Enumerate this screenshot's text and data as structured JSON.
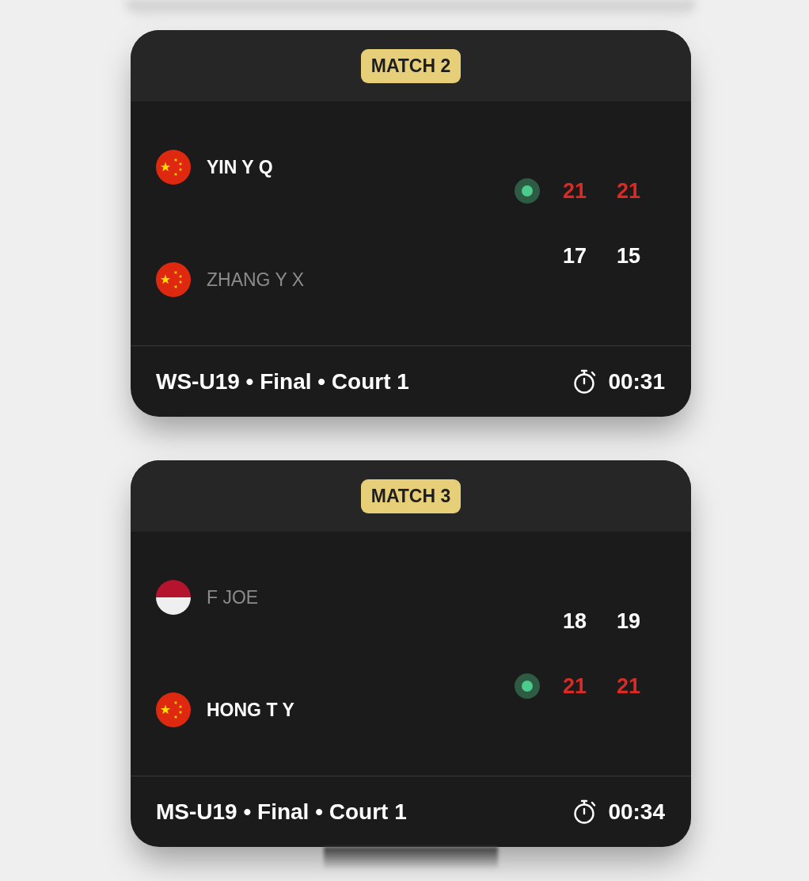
{
  "matches": [
    {
      "badge": "MATCH 2",
      "players": [
        {
          "name": "YIN Y Q",
          "flag": {
            "kind": "china"
          },
          "winner": true,
          "serving": true,
          "scores": [
            "21",
            "21"
          ]
        },
        {
          "name": "ZHANG Y X",
          "flag": {
            "kind": "china"
          },
          "winner": false,
          "serving": false,
          "scores": [
            "17",
            "15"
          ]
        }
      ],
      "info": "WS-U19 • Final • Court 1",
      "duration": "00:31"
    },
    {
      "badge": "MATCH 3",
      "players": [
        {
          "name": "F JOE",
          "flag": {
            "kind": "bicolor"
          },
          "winner": false,
          "serving": false,
          "scores": [
            "18",
            "19"
          ]
        },
        {
          "name": "HONG T Y",
          "flag": {
            "kind": "china"
          },
          "winner": true,
          "serving": true,
          "scores": [
            "21",
            "21"
          ]
        }
      ],
      "info": "MS-U19 • Final • Court 1",
      "duration": "00:34"
    }
  ]
}
